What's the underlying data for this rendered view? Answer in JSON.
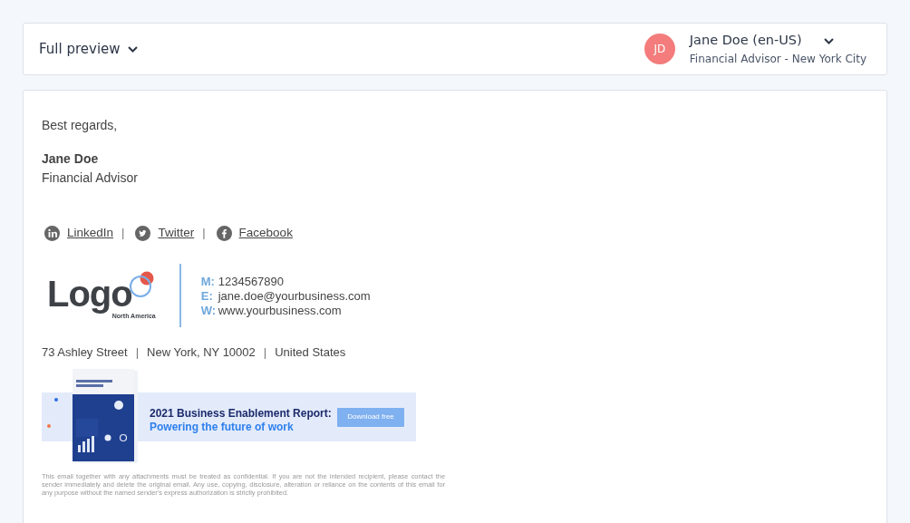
{
  "header": {
    "view_mode": "Full preview",
    "user": {
      "initials": "JD",
      "name": "Jane Doe (en-US)",
      "subtitle": "Financial Advisor - New York City"
    }
  },
  "signature": {
    "closing": "Best regards,",
    "name": "Jane Doe",
    "title": "Financial Advisor",
    "social_links": [
      {
        "kind": "linkedin",
        "label": "LinkedIn"
      },
      {
        "kind": "twitter",
        "label": "Twitter"
      },
      {
        "kind": "facebook",
        "label": "Facebook"
      }
    ],
    "separator": "|",
    "logo": {
      "word": "Logo",
      "region": "North America"
    },
    "contacts": [
      {
        "key": "M:",
        "value": "1234567890"
      },
      {
        "key": "E:",
        "value": "jane.doe@yourbusiness.com"
      },
      {
        "key": "W:",
        "value": "www.yourbusiness.com"
      }
    ],
    "address": [
      "73 Ashley Street",
      "New York, NY 10002",
      "United States"
    ],
    "banner": {
      "headline": "2021 Business Enablement Report:",
      "subline": "Powering the future of work",
      "button": "Download free"
    },
    "disclaimer": "This email together with any attachments must be treated as confidential. If you are not the intended recipient, please contact the sender immediately and delete the original email. Any use, copying, disclosure, alteration or reliance on the contents of this email for any purpose without the named sender's express authorization is strictly prohibited."
  }
}
